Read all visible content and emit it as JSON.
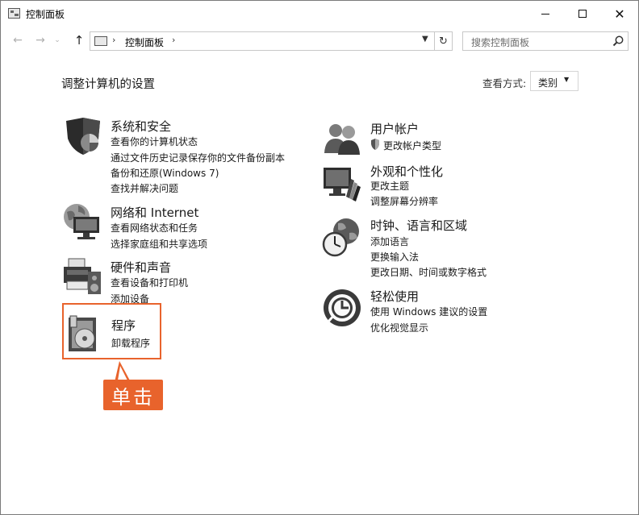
{
  "window": {
    "title": "控制面板"
  },
  "address": {
    "path": "控制面板",
    "search_placeholder": "搜索控制面板"
  },
  "main": {
    "heading": "调整计算机的设置",
    "view_by_label": "查看方式:",
    "view_by_value": "类别"
  },
  "categories_left": [
    {
      "title": "系统和安全",
      "icon": "shield-icon",
      "links": [
        "查看你的计算机状态",
        "通过文件历史记录保存你的文件备份副本",
        "备份和还原(Windows 7)",
        "查找并解决问题"
      ]
    },
    {
      "title": "网络和 Internet",
      "icon": "network-globe-icon",
      "links": [
        "查看网络状态和任务",
        "选择家庭组和共享选项"
      ]
    },
    {
      "title": "硬件和声音",
      "icon": "printer-speaker-icon",
      "links": [
        "查看设备和打印机",
        "添加设备"
      ]
    },
    {
      "title": "程序",
      "icon": "programs-disc-icon",
      "links": [
        "卸载程序"
      ]
    }
  ],
  "categories_right": [
    {
      "title": "用户帐户",
      "icon": "users-icon",
      "links": [
        "更改帐户类型"
      ]
    },
    {
      "title": "外观和个性化",
      "icon": "monitor-palette-icon",
      "links": [
        "更改主题",
        "调整屏幕分辨率"
      ]
    },
    {
      "title": "时钟、语言和区域",
      "icon": "clock-globe-icon",
      "links": [
        "添加语言",
        "更换输入法",
        "更改日期、时间或数字格式"
      ]
    },
    {
      "title": "轻松使用",
      "icon": "ease-of-access-icon",
      "links": [
        "使用 Windows 建议的设置",
        "优化视觉显示"
      ]
    }
  ],
  "annotation": {
    "callout_text": "单击",
    "accent_color": "#e8632c"
  }
}
